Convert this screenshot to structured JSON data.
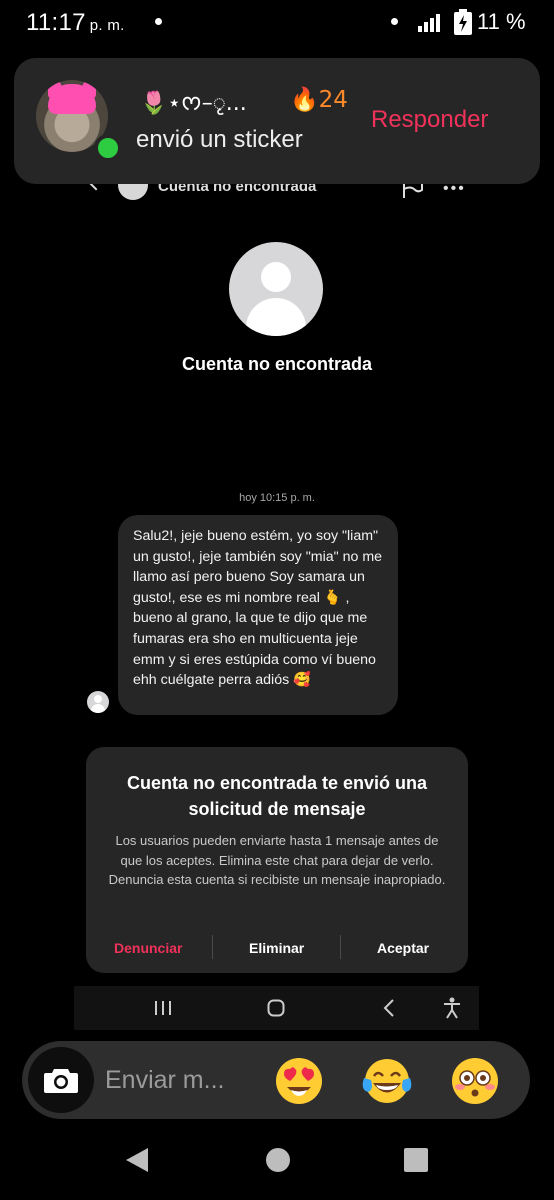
{
  "status_bar": {
    "time": "11:17",
    "ampm": "p. m.",
    "battery": "11 %"
  },
  "notification": {
    "sender_name": "🌷⋆ᰔ–ृ...",
    "streak": "🔥24",
    "text": "envió un sticker",
    "reply_label": "Responder",
    "icons": [
      "profile-avatar",
      "online-indicator"
    ]
  },
  "header": {
    "title": "Cuenta no encontrada",
    "icons": [
      "back-icon",
      "flag-icon",
      "more-icon"
    ]
  },
  "profile": {
    "name": "Cuenta no encontrada"
  },
  "conversation": {
    "timestamp": "hoy 10:15 p. m.",
    "message": "Salu2!, jeje bueno estém, yo soy \"liam\" un gusto!, jeje también soy \"mia\" no me llamo así pero bueno Soy samara un gusto!, ese es mi nombre real 🫰 , bueno al grano, la que te dijo que me fumaras era sho en multicuenta jeje emm y si eres estúpida como ví bueno ehh cuélgate perra adiós 🥰"
  },
  "request_card": {
    "title": "Cuenta no encontrada te envió una solicitud de mensaje",
    "body": "Los usuarios pueden enviarte hasta 1 mensaje antes de que los aceptes. Elimina este chat para dejar de verlo. Denuncia esta cuenta si recibiste un mensaje inapropiado.",
    "report_label": "Denunciar",
    "delete_label": "Eliminar",
    "accept_label": "Aceptar"
  },
  "inner_nav": {
    "icons": [
      "recents-icon",
      "home-icon",
      "back-icon",
      "accessibility-icon"
    ]
  },
  "composer": {
    "placeholder": "Enviar m...",
    "quick_emojis": [
      "heart-eyes-emoji",
      "tears-of-joy-emoji",
      "flushed-emoji"
    ]
  },
  "system_nav": {
    "icons": [
      "back-icon",
      "home-icon",
      "recents-icon"
    ]
  },
  "colors": {
    "background": "#000000",
    "surface": "#262626",
    "accent_red": "#f0325a",
    "streak_orange": "#ff8a2a",
    "online_green": "#2ecc40"
  }
}
